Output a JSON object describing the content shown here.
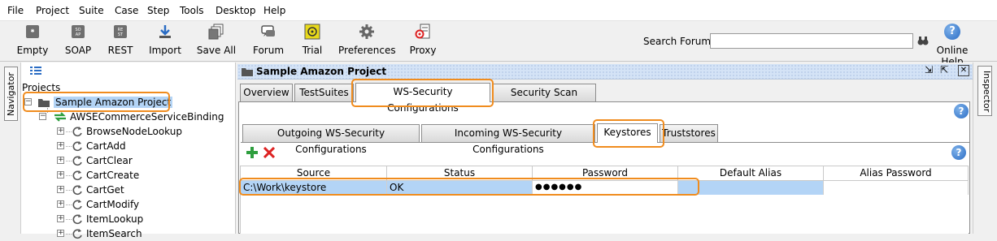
{
  "menu": [
    "File",
    "Project",
    "Suite",
    "Case",
    "Step",
    "Tools",
    "Desktop",
    "Help"
  ],
  "toolbar": {
    "buttons": [
      {
        "label": "Empty",
        "icon": "empty-project-icon"
      },
      {
        "label": "SOAP",
        "icon": "soap-icon"
      },
      {
        "label": "REST",
        "icon": "rest-icon"
      },
      {
        "label": "Import",
        "icon": "import-icon"
      },
      {
        "label": "Save All",
        "icon": "save-all-icon"
      },
      {
        "label": "Forum",
        "icon": "forum-icon"
      },
      {
        "label": "Trial",
        "icon": "trial-icon"
      },
      {
        "label": "Preferences",
        "icon": "gear-icon"
      },
      {
        "label": "Proxy",
        "icon": "proxy-icon"
      }
    ],
    "search_label": "Search Forum",
    "search_value": "",
    "online_help": "Online Help"
  },
  "navigator": {
    "tab_label": "Navigator",
    "root": "Projects",
    "project": "Sample Amazon Project",
    "interface": "AWSECommerceServiceBinding",
    "operations": [
      "BrowseNodeLookup",
      "CartAdd",
      "CartClear",
      "CartCreate",
      "CartGet",
      "CartModify",
      "ItemLookup",
      "ItemSearch"
    ]
  },
  "inspector": {
    "tab_label": "Inspector"
  },
  "editor": {
    "title": "Sample Amazon Project",
    "tabs": [
      "Overview",
      "TestSuites",
      "WS-Security Configurations",
      "Security Scan Defaults"
    ],
    "subtabs": [
      "Outgoing WS-Security Configurations",
      "Incoming WS-Security Configurations",
      "Keystores",
      "Truststores"
    ],
    "table": {
      "columns": [
        "Source",
        "Status",
        "Password",
        "Default Alias",
        "Alias Password"
      ],
      "rows": [
        {
          "source": "C:\\Work\\keystore",
          "status": "OK",
          "password": "●●●●●●",
          "default_alias": "",
          "alias_password": ""
        }
      ]
    }
  },
  "colors": {
    "highlight": "#f08c1e",
    "selection": "#b3d4f6",
    "titlebar": "#d4e3f6"
  }
}
